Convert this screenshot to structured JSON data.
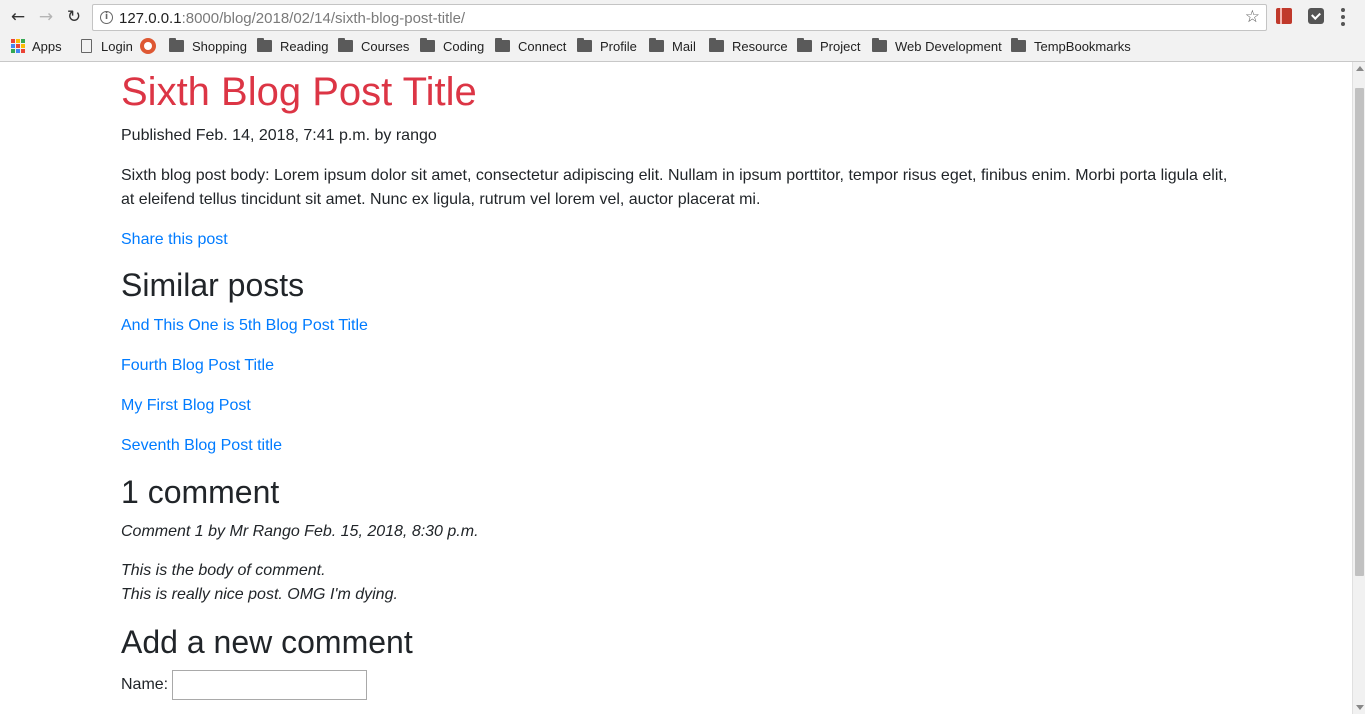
{
  "browser": {
    "url_host": "127.0.0.1",
    "url_rest": ":8000/blog/2018/02/14/sixth-blog-post-title/",
    "bookmarks": [
      "Apps",
      "Login",
      "",
      "Shopping",
      "Reading",
      "Courses",
      "Coding",
      "Connect",
      "Profile",
      "Mail",
      "Resource",
      "Project",
      "Web Development",
      "TempBookmarks"
    ]
  },
  "post": {
    "title": "Sixth Blog Post Title",
    "meta": "Published Feb. 14, 2018, 7:41 p.m. by rango",
    "body": "Sixth blog post body: Lorem ipsum dolor sit amet, consectetur adipiscing elit. Nullam in ipsum porttitor, tempor risus eget, finibus enim. Morbi porta ligula elit, at eleifend tellus tincidunt sit amet. Nunc ex ligula, rutrum vel lorem vel, auctor placerat mi.",
    "share_label": "Share this post"
  },
  "similar": {
    "heading": "Similar posts",
    "items": [
      "And This One is 5th Blog Post Title",
      "Fourth Blog Post Title",
      "My First Blog Post",
      "Seventh Blog Post title"
    ]
  },
  "comments": {
    "heading": "1 comment",
    "info": "Comment 1 by Mr Rango Feb. 15, 2018, 8:30 p.m.",
    "body_line1": "This is the body of comment.",
    "body_line2": "This is really nice post. OMG I'm dying."
  },
  "form": {
    "heading": "Add a new comment",
    "name_label": "Name:",
    "name_value": ""
  },
  "colors": {
    "title": "#dc3545",
    "link": "#007bff",
    "text": "#212529"
  }
}
